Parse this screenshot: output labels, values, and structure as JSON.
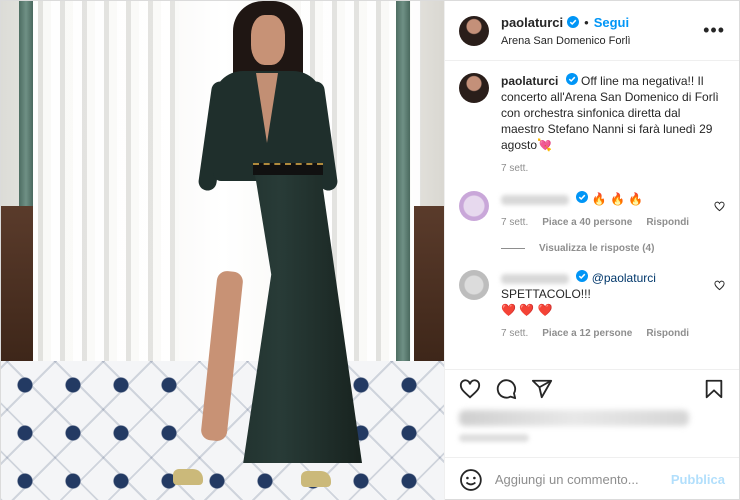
{
  "colors": {
    "accent": "#0095f6",
    "publish_disabled": "#b2dffc",
    "heart": "#ed4956"
  },
  "header": {
    "username": "paolaturci",
    "separator": "•",
    "follow_label": "Segui",
    "location": "Arena San Domenico Forlì",
    "more_icon": "more-horizontal-icon"
  },
  "caption": {
    "username": "paolaturci",
    "text": "Off line ma negativa!! Il concerto all'Arena San Domenico di Forlì con orchestra sinfonica diretta dal maestro Stefano Nanni si farà lunedì 29 agosto",
    "emoji": "💘",
    "time": "7 sett."
  },
  "comments": [
    {
      "emoji_text": "🔥 🔥 🔥",
      "time": "7 sett.",
      "likes": "Piace a 40 persone",
      "reply": "Rispondi"
    },
    {
      "mention": "@paolaturci",
      "text": "SPETTACOLO!!!",
      "hearts": "❤️ ❤️ ❤️",
      "time": "7 sett.",
      "likes": "Piace a 12 persone",
      "reply": "Rispondi"
    }
  ],
  "view_replies": "Visualizza le risposte (4)",
  "add_comment": {
    "placeholder": "Aggiungi un commento...",
    "publish_label": "Pubblica"
  }
}
